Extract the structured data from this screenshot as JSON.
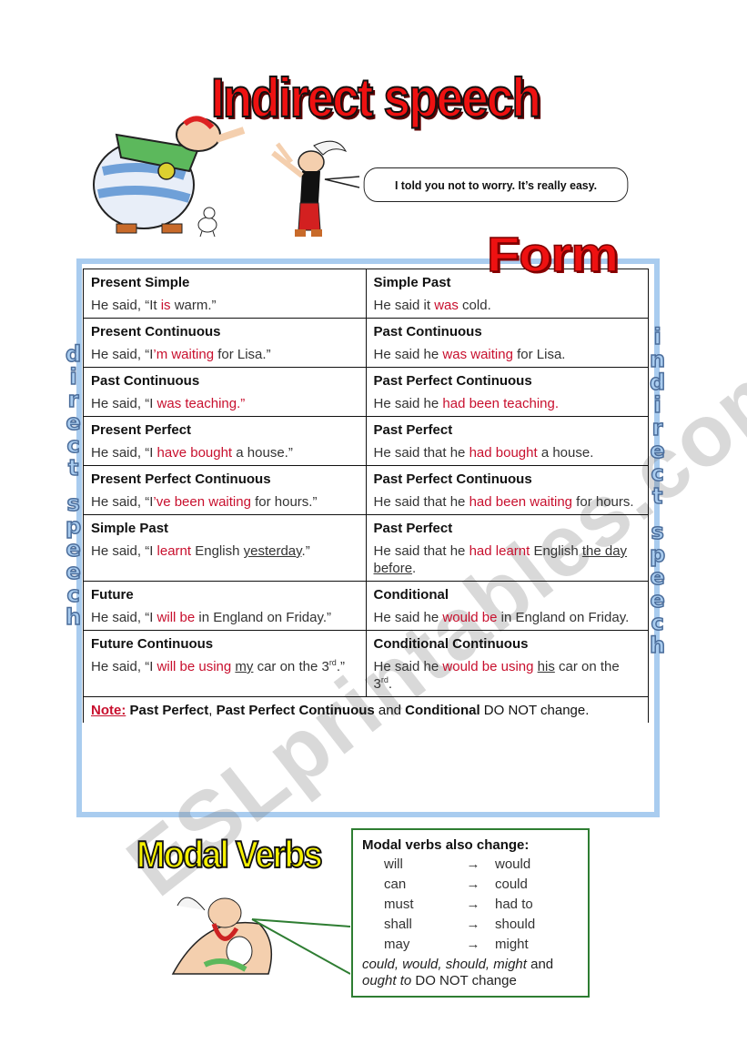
{
  "header": {
    "title": "Indirect speech",
    "speech_bubble": "I told you not to worry. It’s really easy."
  },
  "section_title": "Form",
  "side_labels": {
    "left": [
      "d",
      "i",
      "r",
      "e",
      "c",
      "t",
      "",
      "s",
      "p",
      "e",
      "e",
      "c",
      "h"
    ],
    "right": [
      "i",
      "n",
      "d",
      "i",
      "r",
      "e",
      "c",
      "t",
      "",
      "s",
      "p",
      "e",
      "e",
      "c",
      "h"
    ]
  },
  "watermark": "ESLprintables.com",
  "table": {
    "rows": [
      {
        "direct": {
          "tense": "Present Simple",
          "parts": [
            [
              "He said, “It ",
              ""
            ],
            [
              "is",
              "red"
            ],
            [
              " warm.”",
              ""
            ]
          ]
        },
        "indirect": {
          "tense": "Simple Past",
          "parts": [
            [
              "He said it ",
              ""
            ],
            [
              "was",
              "red"
            ],
            [
              " cold.",
              ""
            ]
          ]
        }
      },
      {
        "direct": {
          "tense": "Present Continuous",
          "parts": [
            [
              "He said, “I",
              ""
            ],
            [
              "’m waiting",
              "red"
            ],
            [
              " for Lisa.”",
              ""
            ]
          ]
        },
        "indirect": {
          "tense": "Past Continuous",
          "parts": [
            [
              "He said he ",
              ""
            ],
            [
              "was waiting",
              "red"
            ],
            [
              " for Lisa.",
              ""
            ]
          ]
        }
      },
      {
        "direct": {
          "tense": "Past Continuous",
          "parts": [
            [
              "He said, “I ",
              ""
            ],
            [
              "was teaching.”",
              "red"
            ]
          ]
        },
        "indirect": {
          "tense": "Past Perfect Continuous",
          "parts": [
            [
              "He said he ",
              ""
            ],
            [
              "had been teaching.",
              "red"
            ]
          ]
        }
      },
      {
        "direct": {
          "tense": "Present Perfect",
          "parts": [
            [
              "He said, “I ",
              ""
            ],
            [
              "have bought",
              "red"
            ],
            [
              " a house.”",
              ""
            ]
          ]
        },
        "indirect": {
          "tense": "Past Perfect",
          "parts": [
            [
              "He said that he ",
              ""
            ],
            [
              "had bought",
              "red"
            ],
            [
              " a house.",
              ""
            ]
          ]
        }
      },
      {
        "direct": {
          "tense": "Present Perfect Continuous",
          "parts": [
            [
              "He said, “I",
              ""
            ],
            [
              "’ve been waiting",
              "red"
            ],
            [
              " for hours.”",
              ""
            ]
          ]
        },
        "indirect": {
          "tense": "Past Perfect Continuous",
          "parts": [
            [
              "He said that he ",
              ""
            ],
            [
              "had been waiting",
              "red"
            ],
            [
              " for hours.",
              ""
            ]
          ]
        }
      },
      {
        "direct": {
          "tense": "Simple Past",
          "parts": [
            [
              "He said, “I ",
              ""
            ],
            [
              "learnt",
              "red"
            ],
            [
              " English ",
              ""
            ],
            [
              "yesterday",
              "u"
            ],
            [
              ".”",
              ""
            ]
          ]
        },
        "indirect": {
          "tense": "Past Perfect",
          "parts": [
            [
              "He said that he ",
              ""
            ],
            [
              "had learnt",
              "red"
            ],
            [
              " English ",
              ""
            ],
            [
              "the day before",
              "u"
            ],
            [
              ".",
              ""
            ]
          ]
        }
      },
      {
        "direct": {
          "tense": "Future",
          "parts": [
            [
              "He said, “I ",
              ""
            ],
            [
              "will be",
              "red"
            ],
            [
              " in England on Friday.”",
              ""
            ]
          ]
        },
        "indirect": {
          "tense": "Conditional",
          "parts": [
            [
              "He said he ",
              ""
            ],
            [
              "would be",
              "red"
            ],
            [
              " in England on Friday.",
              ""
            ]
          ]
        }
      },
      {
        "direct": {
          "tense": "Future Continuous",
          "parts": [
            [
              "He said, “I ",
              ""
            ],
            [
              "will be using",
              "red"
            ],
            [
              " ",
              ""
            ],
            [
              "my",
              "u"
            ],
            [
              " car on the 3",
              ""
            ],
            [
              "rd",
              "sup"
            ],
            [
              ".”",
              ""
            ]
          ]
        },
        "indirect": {
          "tense": "Conditional Continuous",
          "parts": [
            [
              "He said he ",
              ""
            ],
            [
              "would be using",
              "red"
            ],
            [
              " ",
              ""
            ],
            [
              "his",
              "u"
            ],
            [
              " car on the 3",
              ""
            ],
            [
              "rd",
              "sup"
            ],
            [
              ".",
              ""
            ]
          ]
        }
      }
    ],
    "note": {
      "label": "Note:",
      "bold1": "Past Perfect",
      "sep1": ", ",
      "bold2": "Past Perfect Continuous",
      "sep2": " and ",
      "bold3": "Conditional",
      "rest": " DO NOT change."
    }
  },
  "modal": {
    "title": "Modal Verbs",
    "heading": "Modal verbs also change:",
    "arrow": "→",
    "pairs": [
      {
        "from": "will",
        "to": "would"
      },
      {
        "from": "can",
        "to": "could"
      },
      {
        "from": "must",
        "to": "had to"
      },
      {
        "from": "shall",
        "to": "should"
      },
      {
        "from": "may",
        "to": "might"
      }
    ],
    "footer_italic": "could, would, should, might",
    "footer_mid": " and ",
    "footer_italic2": "ought to",
    "footer_rest": " DO NOT change"
  }
}
